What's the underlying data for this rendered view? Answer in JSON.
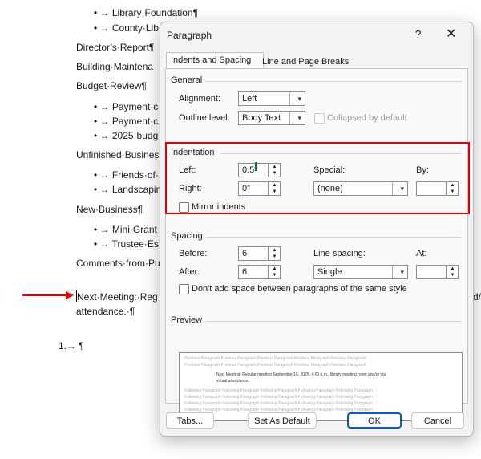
{
  "document": {
    "lines": [
      "• → Library·Foundation¶",
      "• → County·Lib",
      "Director’s·Report¶",
      "Building·Maintena",
      "Budget·Review¶",
      "• → Payment·c",
      "• → Payment·c",
      "• → 2025·budg",
      "Unfinished·Busines",
      "• → Friends·of·",
      "• → Landscapin",
      "New·Business¶",
      "• → Mini·Grant",
      "• → Trustee·Es",
      "Comments·from·Pu",
      "Next·Meeting:·Reg",
      "attendance.·¶",
      "1.→ ¶",
      "d/"
    ]
  },
  "dialog": {
    "title": "Paragraph",
    "help": "?",
    "close": "✕",
    "tabs": [
      "Indents and Spacing",
      "Line and Page Breaks"
    ],
    "general": {
      "heading": "General",
      "alignment_label": "Alignment:",
      "alignment_value": "Left",
      "outline_label": "Outline level:",
      "outline_value": "Body Text",
      "collapsed_label": "Collapsed by default"
    },
    "indentation": {
      "heading": "Indentation",
      "left_label": "Left:",
      "left_value": "0.5\"",
      "right_label": "Right:",
      "right_value": "0\"",
      "special_label": "Special:",
      "special_value": "(none)",
      "by_label": "By:",
      "by_value": "",
      "mirror_label": "Mirror indents"
    },
    "spacing": {
      "heading": "Spacing",
      "before_label": "Before:",
      "before_value": "6",
      "after_label": "After:",
      "after_value": "6",
      "line_label": "Line spacing:",
      "line_value": "Single",
      "at_label": "At:",
      "at_value": "",
      "dont_add_label": "Don't add space between paragraphs of the same style"
    },
    "preview": {
      "heading": "Preview",
      "prev_lines": [
        "Previous Paragraph Previous Paragraph Previous Paragraph Previous Paragraph Previous Paragraph",
        "Previous Paragraph Previous Paragraph Previous Paragraph Previous Paragraph Previous Paragraph"
      ],
      "sample_lines": [
        "Next Meeting: Regular meeting September 16, 2025, 4:00 p.m., library meeting room and/or via",
        "virtual attendance."
      ],
      "follow_lines": [
        "Following Paragraph Following Paragraph Following Paragraph Following Paragraph Following Paragraph",
        "Following Paragraph Following Paragraph Following Paragraph Following Paragraph Following Paragraph",
        "Following Paragraph Following Paragraph Following Paragraph Following Paragraph Following Paragraph",
        "Following Paragraph Following Paragraph Following Paragraph Following Paragraph Following Paragraph"
      ]
    },
    "buttons": {
      "tabs": "Tabs...",
      "set_default": "Set As Default",
      "ok": "OK",
      "cancel": "Cancel"
    }
  },
  "colors": {
    "highlight": "#e00000",
    "arrow": "#e00000",
    "primary_border": "#0a5cb8"
  }
}
